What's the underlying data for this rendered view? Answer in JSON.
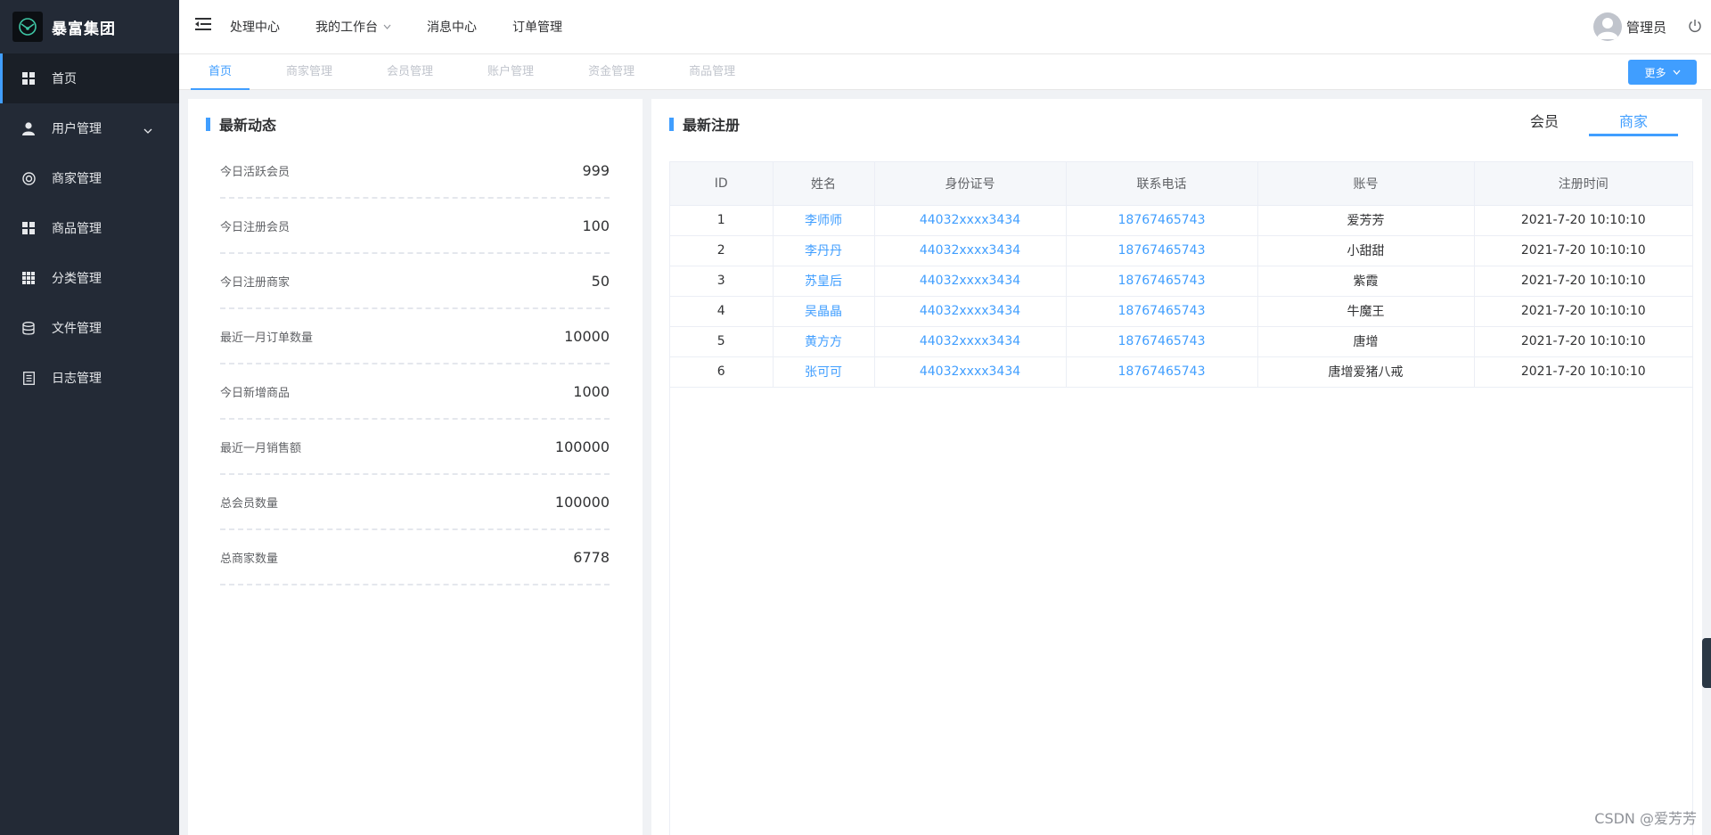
{
  "app": {
    "title": "暴富集团"
  },
  "sidebar": {
    "items": [
      {
        "label": "首页",
        "icon": "dashboard-icon",
        "active": true
      },
      {
        "label": "用户管理",
        "icon": "user-icon",
        "expandable": true
      },
      {
        "label": "商家管理",
        "icon": "lifebuoy-icon"
      },
      {
        "label": "商品管理",
        "icon": "grid-icon"
      },
      {
        "label": "分类管理",
        "icon": "category-grid-icon"
      },
      {
        "label": "文件管理",
        "icon": "database-icon"
      },
      {
        "label": "日志管理",
        "icon": "document-icon"
      }
    ]
  },
  "header": {
    "nav": [
      "处理中心",
      "我的工作台",
      "消息中心",
      "订单管理"
    ],
    "user_name": "管理员"
  },
  "tabs": {
    "items": [
      "首页",
      "商家管理",
      "会员管理",
      "账户管理",
      "资金管理",
      "商品管理"
    ],
    "more_label": "更多"
  },
  "stats": {
    "title": "最新动态",
    "rows": [
      {
        "label": "今日活跃会员",
        "value": "999"
      },
      {
        "label": "今日注册会员",
        "value": "100"
      },
      {
        "label": "今日注册商家",
        "value": "50"
      },
      {
        "label": "最近一月订单数量",
        "value": "10000"
      },
      {
        "label": "今日新增商品",
        "value": "1000"
      },
      {
        "label": "最近一月销售额",
        "value": "100000"
      },
      {
        "label": "总会员数量",
        "value": "100000"
      },
      {
        "label": "总商家数量",
        "value": "6778"
      }
    ]
  },
  "registrations": {
    "title": "最新注册",
    "segments": [
      "会员",
      "商家"
    ],
    "active_segment": "商家",
    "columns": [
      "ID",
      "姓名",
      "身份证号",
      "联系电话",
      "账号",
      "注册时间"
    ],
    "rows": [
      [
        "1",
        "李师师",
        "44032xxxx3434",
        "18767465743",
        "爱芳芳",
        "2021-7-20 10:10:10"
      ],
      [
        "2",
        "李丹丹",
        "44032xxxx3434",
        "18767465743",
        "小甜甜",
        "2021-7-20 10:10:10"
      ],
      [
        "3",
        "苏皇后",
        "44032xxxx3434",
        "18767465743",
        "紫霞",
        "2021-7-20 10:10:10"
      ],
      [
        "4",
        "吴晶晶",
        "44032xxxx3434",
        "18767465743",
        "牛魔王",
        "2021-7-20 10:10:10"
      ],
      [
        "5",
        "黄方方",
        "44032xxxx3434",
        "18767465743",
        "唐增",
        "2021-7-20 10:10:10"
      ],
      [
        "6",
        "张可可",
        "44032xxxx3434",
        "18767465743",
        "唐增爱猪八戒",
        "2021-7-20 10:10:10"
      ]
    ]
  },
  "watermark": "CSDN @爱芳芳",
  "colors": {
    "accent": "#409eff",
    "sidebar_bg": "#232a36"
  }
}
